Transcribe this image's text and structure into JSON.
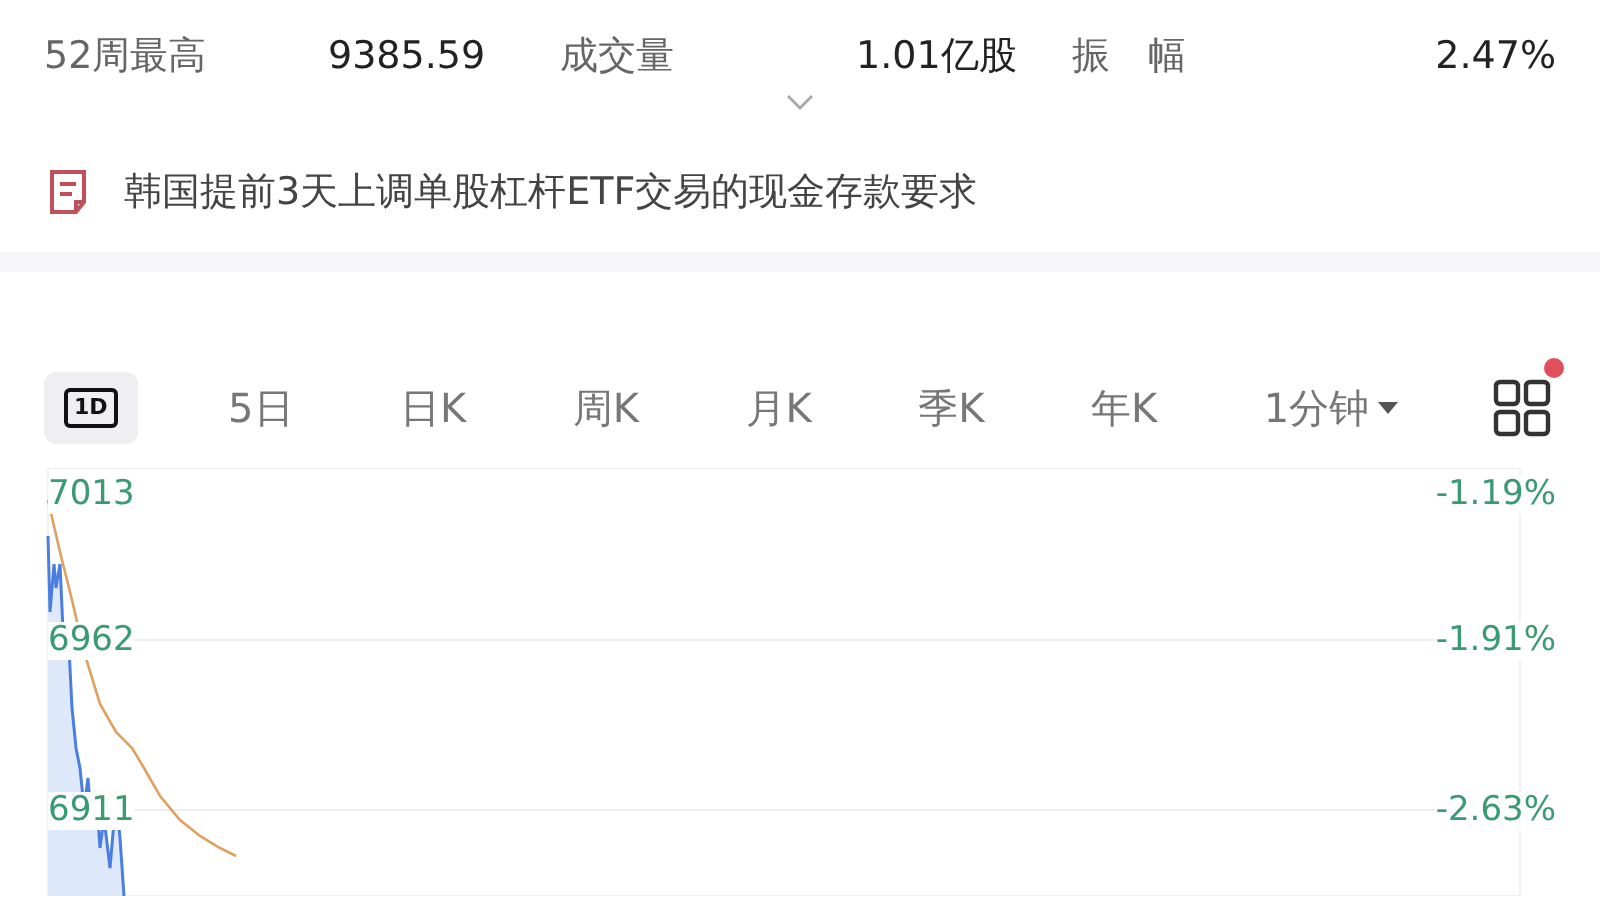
{
  "stats": [
    {
      "label": "52周最高",
      "value": "9385.59"
    },
    {
      "label": "成交量",
      "value": "1.01亿股"
    },
    {
      "label": "振　幅",
      "value": "2.47%"
    }
  ],
  "news": {
    "text": "韩国提前3天上调单股杠杆ETF交易的现金存款要求"
  },
  "period_tabs": [
    {
      "label": "1D",
      "kind": "icon",
      "selected": true
    },
    {
      "label": "5日",
      "kind": "text",
      "selected": false
    },
    {
      "label": "日K",
      "kind": "text",
      "selected": false
    },
    {
      "label": "周K",
      "kind": "text",
      "selected": false
    },
    {
      "label": "月K",
      "kind": "text",
      "selected": false
    },
    {
      "label": "季K",
      "kind": "text",
      "selected": false
    },
    {
      "label": "年K",
      "kind": "text",
      "selected": false
    },
    {
      "label": "1分钟",
      "kind": "dropdown",
      "selected": false
    }
  ],
  "layout_button": {
    "badge": true
  },
  "chart": {
    "left_labels": [
      "7013",
      "6962",
      "6911"
    ],
    "right_labels": [
      "-1.19%",
      "-1.91%",
      "-2.63%"
    ]
  }
}
